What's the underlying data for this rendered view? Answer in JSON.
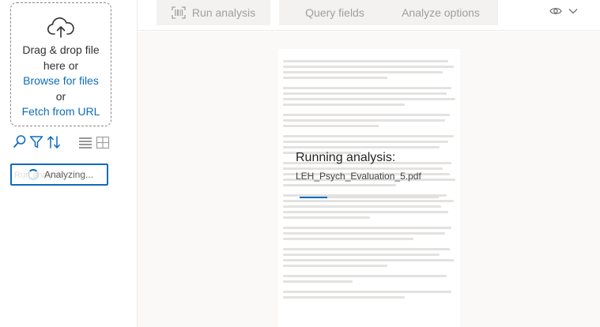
{
  "dropzone": {
    "line1": "Drag & drop file",
    "line2": "here or",
    "browse_link": "Browse for files",
    "or": "or",
    "fetch_link": "Fetch from URL"
  },
  "left_tools": {
    "icons": [
      "search-icon",
      "filter-icon",
      "sort-icon",
      "list-view-icon",
      "grid-view-icon"
    ]
  },
  "status_button": {
    "label": "Analyzing...",
    "ghost_label": "Run analysis"
  },
  "toolbar": {
    "run_analysis": "Run analysis",
    "query_fields": "Query fields",
    "analyze_options": "Analyze options",
    "view_icon": "eye-icon",
    "chevron_icon": "chevron-down-icon"
  },
  "analysis": {
    "title": "Running analysis:",
    "filename": "LEH_Psych_Evaluation_5.pdf",
    "progress": 0.2
  },
  "colors": {
    "accent": "#0f6cbd",
    "button_bg": "#f3f2f1",
    "disabled_text": "#a19f9d",
    "canvas_bg": "#faf9f8"
  }
}
